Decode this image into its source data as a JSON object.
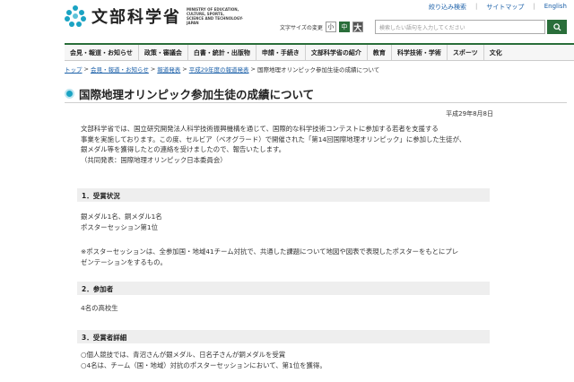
{
  "header": {
    "logo_text": "文部科学省",
    "logo_sub": [
      "MINISTRY OF EDUCATION,",
      "CULTURE, SPORTS,",
      "SCIENCE AND TECHNOLOGY-JAPAN"
    ],
    "util_links": [
      "絞り込み検索",
      "サイトマップ",
      "English"
    ],
    "fontsize_label": "文字サイズの変更",
    "fontsize_options": [
      "小",
      "中",
      "大"
    ],
    "search_placeholder": "検索したい語句を入力してください"
  },
  "gnav": [
    "会見・報道・お知らせ",
    "政策・審議会",
    "白書・統計・出版物",
    "申請・手続き",
    "文部科学省の紹介",
    "教育",
    "科学技術・学術",
    "スポーツ",
    "文化"
  ],
  "breadcrumb": [
    "トップ",
    "会見・報道・お知らせ",
    "報道発表",
    "平成29年度の報道発表",
    "国際地理オリンピック参加生徒の成績について"
  ],
  "page": {
    "title": "国際地理オリンピック参加生徒の成績について",
    "date": "平成29年8月8日",
    "intro": [
      "文部科学省では、国立研究開発法人科学技術振興機構を通じて、国際的な科学技術コンテストに参加する若者を支援する",
      "事業を実施しております。この度、セルビア（ベオグラード）で開催された「第14回国際地理オリンピック」に参加した生徒が、",
      "銀メダル等を獲得したとの連絡を受けましたので、報告いたします。",
      "（共同発表：国際地理オリンピック日本委員会）"
    ],
    "sections": [
      {
        "heading": "1．受賞状況"
      },
      {
        "heading": "2．参加者"
      },
      {
        "heading": "3．受賞者詳細"
      }
    ],
    "awards": [
      "銀メダル1名、銅メダル1名",
      "ポスターセッション第1位"
    ],
    "note": [
      "※ポスターセッションは、全参加国・地域41チーム対抗で、共通した課題について地図や図表で表現したポスターをもとにプレ",
      "ゼンテーションをするもの。"
    ],
    "participants": "4名の高校生",
    "details": [
      "○個人競技では、青沼さんが銀メダル、日名子さんが銅メダルを受賞",
      "○4名は、チーム（国・地域）対抗のポスターセッションにおいて、第1位を獲得。"
    ]
  }
}
